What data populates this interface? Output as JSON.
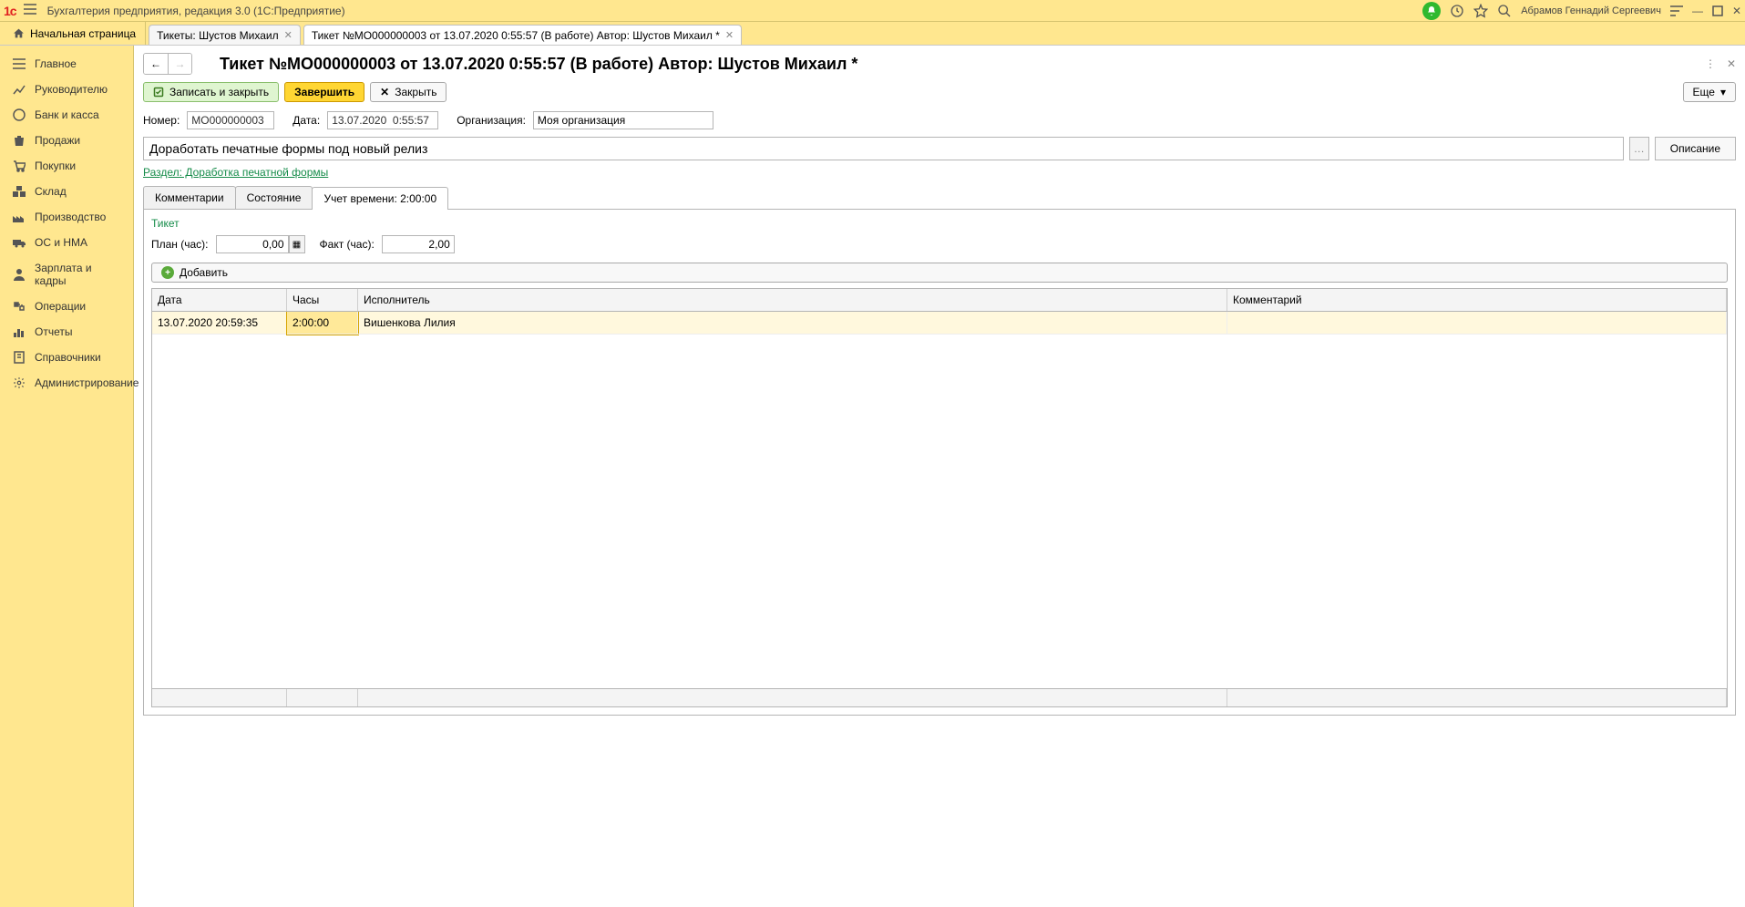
{
  "titlebar": {
    "app_title": "Бухгалтерия предприятия, редакция 3.0  (1С:Предприятие)",
    "username": "Абрамов Геннадий Сергеевич"
  },
  "tabs": {
    "home_label": "Начальная страница",
    "items": [
      {
        "label": "Тикеты: Шустов Михаил",
        "active": false
      },
      {
        "label": "Тикет №МО000000003 от 13.07.2020 0:55:57 (В работе) Автор: Шустов Михаил *",
        "active": true
      }
    ]
  },
  "sidebar": {
    "items": [
      {
        "label": "Главное"
      },
      {
        "label": "Руководителю"
      },
      {
        "label": "Банк и касса"
      },
      {
        "label": "Продажи"
      },
      {
        "label": "Покупки"
      },
      {
        "label": "Склад"
      },
      {
        "label": "Производство"
      },
      {
        "label": "ОС и НМА"
      },
      {
        "label": "Зарплата и кадры"
      },
      {
        "label": "Операции"
      },
      {
        "label": "Отчеты"
      },
      {
        "label": "Справочники"
      },
      {
        "label": "Администрирование"
      }
    ]
  },
  "page": {
    "title": "Тикет №МО000000003 от 13.07.2020 0:55:57 (В работе) Автор: Шустов Михаил *"
  },
  "toolbar": {
    "save_close": "Записать и закрыть",
    "finish": "Завершить",
    "close": "Закрыть",
    "more": "Еще"
  },
  "form": {
    "number_label": "Номер:",
    "number_value": "МО000000003",
    "date_label": "Дата:",
    "date_value": "13.07.2020  0:55:57",
    "org_label": "Организация:",
    "org_value": "Моя организация",
    "subject_value": "Доработать печатные формы под новый релиз",
    "desc_btn": "Описание",
    "section_link": "Раздел: Доработка печатной формы"
  },
  "subtabs": {
    "items": [
      {
        "label": "Комментарии"
      },
      {
        "label": "Состояние"
      },
      {
        "label": "Учет времени: 2:00:00"
      }
    ],
    "active": 2
  },
  "time_tracking": {
    "ticket_link": "Тикет",
    "plan_label": "План (час):",
    "plan_value": "0,00",
    "fact_label": "Факт (час):",
    "fact_value": "2,00",
    "add_btn": "Добавить",
    "columns": {
      "date": "Дата",
      "hours": "Часы",
      "executor": "Исполнитель",
      "comment": "Комментарий"
    },
    "rows": [
      {
        "date": "13.07.2020 20:59:35",
        "hours": "2:00:00",
        "executor": "Вишенкова Лилия",
        "comment": ""
      }
    ]
  }
}
